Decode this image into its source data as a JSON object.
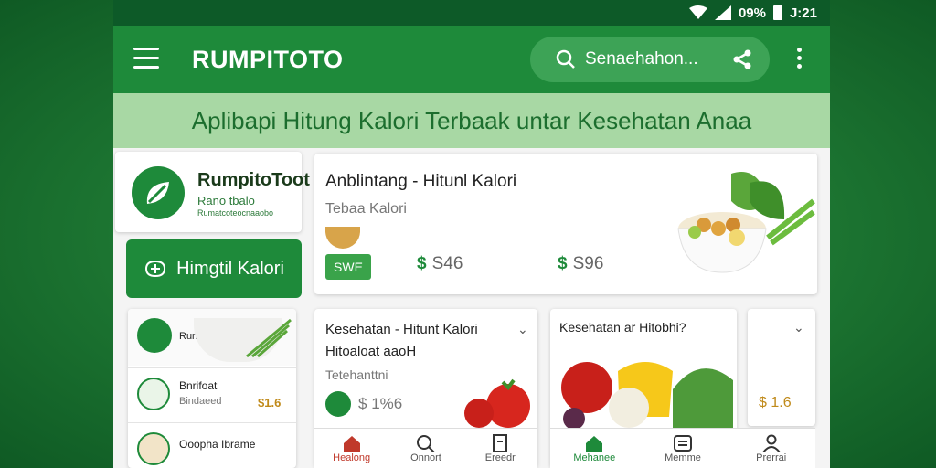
{
  "status": {
    "battery": "09%",
    "time": "J:21"
  },
  "appbar": {
    "title": "RUMPITOTO",
    "search_label": "Senaehahon..."
  },
  "banner": {
    "text": "Aplibapi Hitung Kalori Terbaak untar Kesehatan Anaa"
  },
  "profile_card": {
    "title": "RumpitoToot",
    "subtitle": "Rano tbalo",
    "caption": "Rumatcoteocnaaobo"
  },
  "hitung_button": {
    "label": "Himgtil Kalori"
  },
  "left_list": [
    {
      "title": "Runolteoon"
    },
    {
      "title": "Bnrifoat",
      "subtitle": "Bindaeed",
      "value": "$1.6"
    },
    {
      "title": "Ooopha Ibrame"
    }
  ],
  "featured": {
    "title": "Anblintang - Hitunl Kalori",
    "subtitle": "Tebaa Kalori",
    "save_label": "SWE",
    "price1": "S46",
    "price2": "S96"
  },
  "card2": {
    "title": "Kesehatan - Hitunt Kalori",
    "title2": "Hitoaloat aaoH",
    "subtitle": "Tetehanttni",
    "price": "1%6"
  },
  "card3": {
    "title": "Kesehatan ar Hitobhi?"
  },
  "card4": {
    "price": "$ 1.6"
  },
  "nav_left": [
    {
      "label": "Healong",
      "icon": "home-icon"
    },
    {
      "label": "Onnort",
      "icon": "search-icon"
    },
    {
      "label": "Ereedr",
      "icon": "document-icon"
    }
  ],
  "nav_right": [
    {
      "label": "Mehanee",
      "icon": "home-icon"
    },
    {
      "label": "Memme",
      "icon": "list-icon"
    },
    {
      "label": "Prerrai",
      "icon": "profile-icon"
    }
  ],
  "colors": {
    "primary": "#1e8a3a",
    "banner_bg": "#a8d8a4",
    "status_bar": "#0d5a28",
    "active_nav": "#c0392b"
  }
}
